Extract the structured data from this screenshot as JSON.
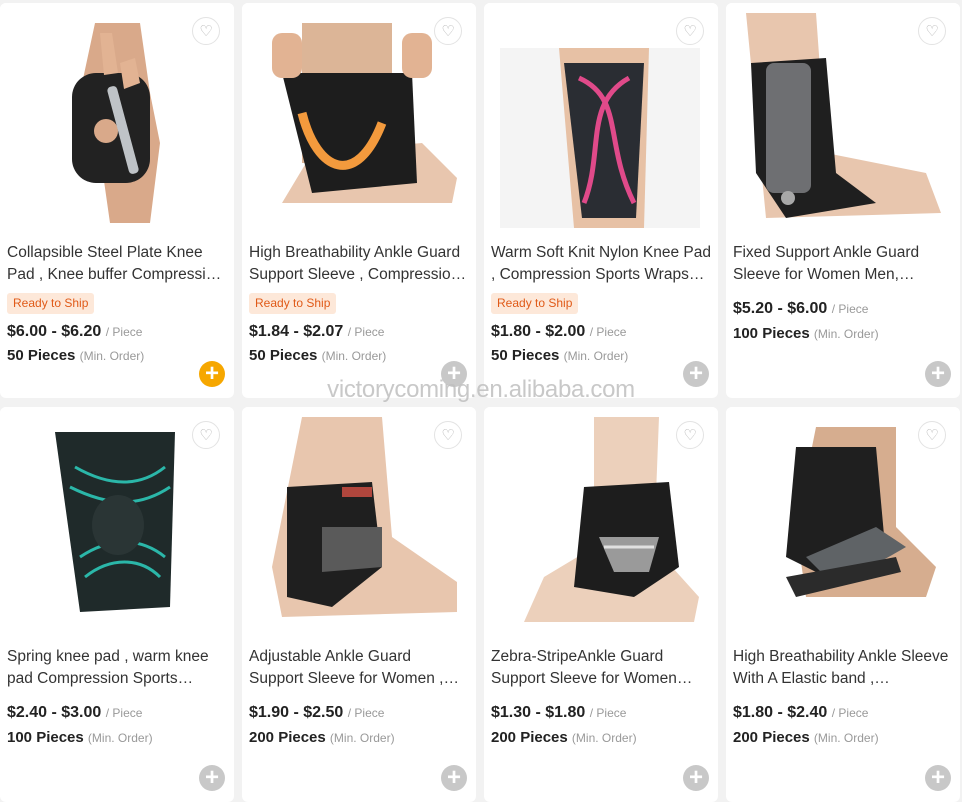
{
  "watermark": "victorycoming.en.alibaba.com",
  "products": [
    {
      "title": "Collapsible Steel Plate Knee Pad , Knee buffer Compression Sports Wraps",
      "tag": "Ready to Ship",
      "price": "$6.00 - $6.20",
      "unit": "/ Piece",
      "moq": "50 Pieces",
      "min_order": "(Min. Order)",
      "image_icon": "knee-pad-hinged-image",
      "add_active": true
    },
    {
      "title": "High Breathability Ankle Guard Support Sleeve , Compression Ankle Support",
      "tag": "Ready to Ship",
      "price": "$1.84 - $2.07",
      "unit": "/ Piece",
      "moq": "50 Pieces",
      "min_order": "(Min. Order)",
      "image_icon": "ankle-guard-orange-image",
      "add_active": false
    },
    {
      "title": "Warm Soft Knit Nylon Knee Pad , Compression Sports Wraps Sleeve",
      "tag": "Ready to Ship",
      "price": "$1.80 - $2.00",
      "unit": "/ Piece",
      "moq": "50 Pieces",
      "min_order": "(Min. Order)",
      "image_icon": "knit-knee-sleeve-image",
      "add_active": false
    },
    {
      "title": "Fixed Support Ankle Guard Sleeve for Women Men, Adjustable",
      "tag": "",
      "price": "$5.20 - $6.00",
      "unit": "/ Piece",
      "moq": "100 Pieces",
      "min_order": "(Min. Order)",
      "image_icon": "ankle-brace-fixed-image",
      "add_active": false
    },
    {
      "title": "Spring knee pad , warm knee pad Compression Sports Sleeve",
      "tag": "",
      "price": "$2.40 - $3.00",
      "unit": "/ Piece",
      "moq": "100 Pieces",
      "min_order": "(Min. Order)",
      "image_icon": "spring-knee-pad-image",
      "add_active": false
    },
    {
      "title": "Adjustable Ankle Guard Support Sleeve for Women , Men",
      "tag": "",
      "price": "$1.90 - $2.50",
      "unit": "/ Piece",
      "moq": "200 Pieces",
      "min_order": "(Min. Order)",
      "image_icon": "adjustable-ankle-guard-image",
      "add_active": false
    },
    {
      "title": "Zebra-StripeAnkle Guard Support Sleeve for Women Men",
      "tag": "",
      "price": "$1.30 - $1.80",
      "unit": "/ Piece",
      "moq": "200 Pieces",
      "min_order": "(Min. Order)",
      "image_icon": "zebra-ankle-guard-image",
      "add_active": false
    },
    {
      "title": "High Breathability Ankle Sleeve With A Elastic band , Compression",
      "tag": "",
      "price": "$1.80 - $2.40",
      "unit": "/ Piece",
      "moq": "200 Pieces",
      "min_order": "(Min. Order)",
      "image_icon": "elastic-band-ankle-sleeve-image",
      "add_active": false
    }
  ],
  "colors": {
    "tag_text": "#e05a18",
    "tag_bg": "#fde8d9",
    "add_active": "#f6a700",
    "add_inactive": "#c8c8c8",
    "price_text": "#222222"
  }
}
